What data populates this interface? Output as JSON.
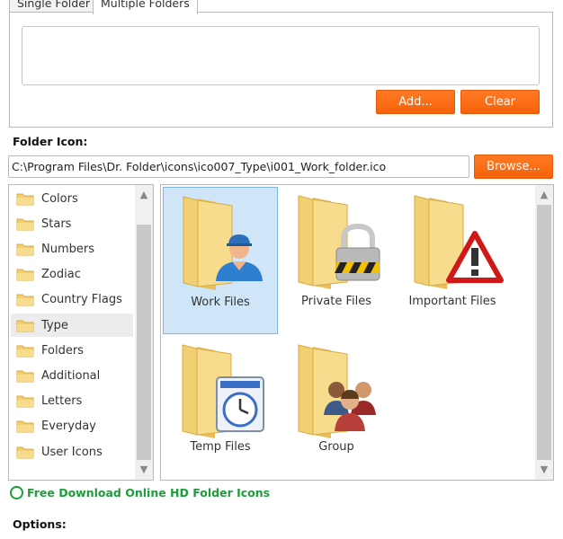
{
  "tabs": [
    {
      "label": "Single Folder",
      "active": false
    },
    {
      "label": "Multiple Folders",
      "active": true
    }
  ],
  "folders_panel": {
    "add_label": "Add...",
    "clear_label": "Clear"
  },
  "folder_icon": {
    "label": "Folder Icon:",
    "path": "C:\\Program Files\\Dr. Folder\\icons\\ico007_Type\\i001_Work_folder.ico",
    "browse_label": "Browse..."
  },
  "categories": [
    {
      "label": "Colors",
      "selected": false
    },
    {
      "label": "Stars",
      "selected": false
    },
    {
      "label": "Numbers",
      "selected": false
    },
    {
      "label": "Zodiac",
      "selected": false
    },
    {
      "label": "Country Flags",
      "selected": false
    },
    {
      "label": "Type",
      "selected": true
    },
    {
      "label": "Folders",
      "selected": false
    },
    {
      "label": "Additional",
      "selected": false
    },
    {
      "label": "Letters",
      "selected": false
    },
    {
      "label": "Everyday",
      "selected": false
    },
    {
      "label": "User Icons",
      "selected": false
    }
  ],
  "icons": [
    {
      "label": "Work Files",
      "badge": "worker-icon",
      "selected": true
    },
    {
      "label": "Private Files",
      "badge": "padlock-icon",
      "selected": false
    },
    {
      "label": "Important Files",
      "badge": "warning-icon",
      "selected": false
    },
    {
      "label": "Temp Files",
      "badge": "clock-icon",
      "selected": false
    },
    {
      "label": "Group",
      "badge": "people-group-icon",
      "selected": false
    }
  ],
  "download_link": "Free Download Online HD Folder Icons",
  "options_label": "Options:",
  "colors": {
    "accent_orange": "#f7620b",
    "selection_blue": "#cfe6f8",
    "link_green": "#1e9c3c",
    "folder_yellow": "#f3d27a"
  }
}
